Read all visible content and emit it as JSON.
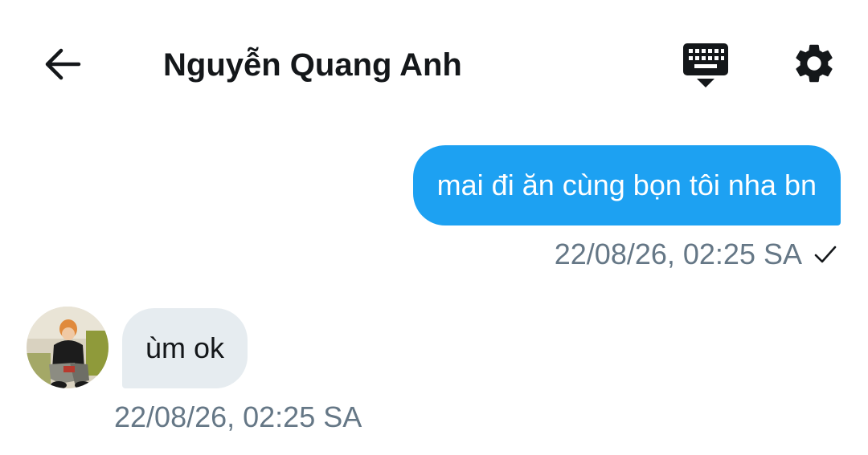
{
  "header": {
    "title": "Nguyễn Quang Anh",
    "back_icon": "arrow-left-icon",
    "keyboard_icon": "keyboard-hide-icon",
    "settings_icon": "gear-icon"
  },
  "messages": [
    {
      "direction": "outgoing",
      "text": "mai đi ăn cùng bọn tôi nha bn",
      "timestamp": "22/08/26, 02:25 SA",
      "status_icon": "checkmark-icon"
    },
    {
      "direction": "incoming",
      "text": "ùm ok",
      "timestamp": "22/08/26, 02:25 SA",
      "avatar_icon": "avatar"
    }
  ],
  "colors": {
    "outgoing_bubble": "#1da1f2",
    "incoming_bubble": "#e6ecf0",
    "meta_text": "#657786",
    "title_text": "#14171a"
  }
}
